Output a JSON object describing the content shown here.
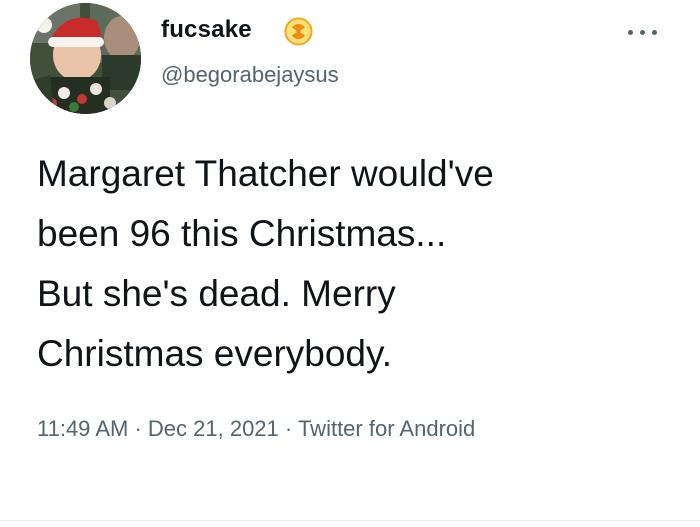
{
  "author": {
    "display_name": "fucsake",
    "handle": "@begorabejaysus",
    "avatar_icon": "avatar-santa-hat",
    "badge_icon": "radiation-icon"
  },
  "tweet": {
    "text": "Margaret Thatcher would've\nbeen 96 this Christmas...\nBut she's dead. Merry\nChristmas everybody.",
    "time": "11:49 AM",
    "separator": "·",
    "date": "Dec 21, 2021",
    "source": "Twitter for Android"
  },
  "menu": {
    "icon": "more-icon"
  },
  "colors": {
    "text": "#0f1419",
    "muted": "#536471",
    "badge": "#f0a81c"
  }
}
